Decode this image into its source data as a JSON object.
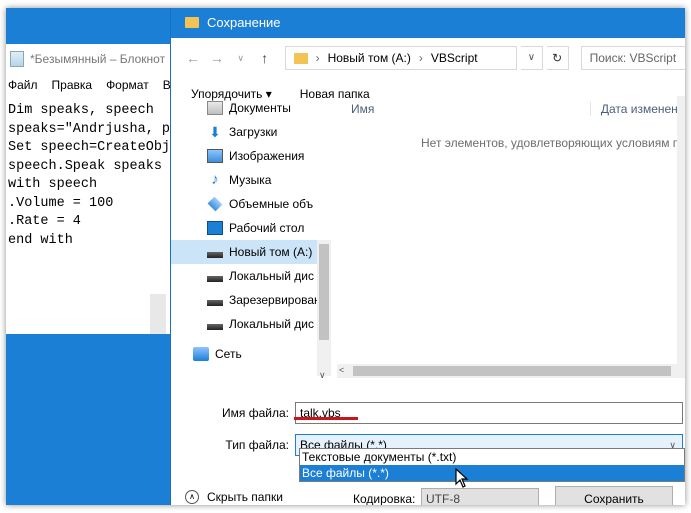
{
  "notepad": {
    "title": "*Безымянный – Блокнот",
    "menu": [
      "Файл",
      "Правка",
      "Формат",
      "В"
    ],
    "lines": [
      "Dim speaks, speech",
      "speaks=\"Andrjusha, p",
      "Set speech=CreateObj",
      "speech.Speak speaks",
      "with speech",
      ".Volume = 100",
      ".Rate = 4",
      "end with"
    ]
  },
  "dialog": {
    "title": "Сохранение",
    "path": [
      "Новый том (A:)",
      "VBScript"
    ],
    "search_placeholder": "Поиск: VBScript",
    "toolbar": {
      "organize": "Упорядочить ▾",
      "new_folder": "Новая папка"
    },
    "tree": [
      {
        "label": "Документы",
        "icon": "doc"
      },
      {
        "label": "Загрузки",
        "icon": "dl"
      },
      {
        "label": "Изображения",
        "icon": "img"
      },
      {
        "label": "Музыка",
        "icon": "music"
      },
      {
        "label": "Объемные объ",
        "icon": "obj"
      },
      {
        "label": "Рабочий стол",
        "icon": "desk"
      },
      {
        "label": "Новый том (A:)",
        "icon": "drive",
        "selected": true
      },
      {
        "label": "Локальный дис",
        "icon": "drive"
      },
      {
        "label": "Зарезервирован",
        "icon": "drive"
      },
      {
        "label": "Локальный дис",
        "icon": "drive"
      }
    ],
    "network": "Сеть",
    "columns": {
      "name": "Имя",
      "date": "Дата изменения"
    },
    "empty_message": "Нет элементов, удовлетворяющих условиям по",
    "filename_label": "Имя файла:",
    "filename_value": "talk.vbs",
    "filetype_label": "Тип файла:",
    "filetype_value": "Все файлы  (*.*)",
    "filetype_options": [
      "Текстовые документы (*.txt)",
      "Все файлы  (*.*)"
    ],
    "hide_folders": "Скрыть папки",
    "encoding_label": "Кодировка:",
    "encoding_value": "UTF-8",
    "save_button": "Сохранить"
  }
}
